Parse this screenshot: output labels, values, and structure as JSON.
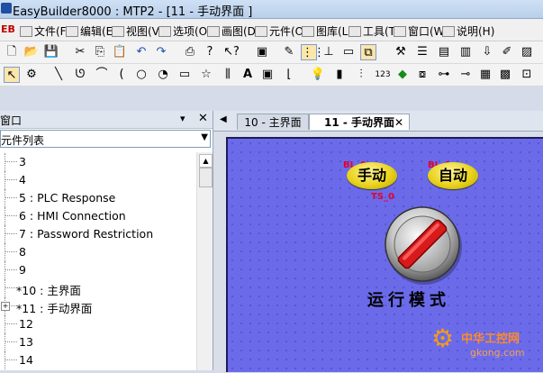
{
  "titlebar": {
    "title": "EasyBuilder8000 : MTP2 - [11 - 手动界面 ]"
  },
  "menubar": {
    "logo": "EB",
    "items": [
      {
        "label": "文件(F)"
      },
      {
        "label": "编辑(E)"
      },
      {
        "label": "视图(V)"
      },
      {
        "label": "选项(O)"
      },
      {
        "label": "画图(D)"
      },
      {
        "label": "元件(O)"
      },
      {
        "label": "图库(L)"
      },
      {
        "label": "工具(T)"
      },
      {
        "label": "窗口(W)"
      },
      {
        "label": "说明(H)"
      }
    ]
  },
  "toolbar1": {
    "icons": [
      "new-file-icon",
      "open-folder-icon",
      "save-icon",
      "cut-icon",
      "copy-icon",
      "paste-icon",
      "undo-icon",
      "redo-icon",
      "print-icon",
      "help-icon",
      "context-help-icon",
      "component-icon",
      "pen-icon",
      "grid-icon",
      "align-icon",
      "frame-icon",
      "overlap-icon",
      "tools-icon",
      "compile-icon",
      "offline-sim-icon",
      "online-sim-icon",
      "download-icon",
      "edit-icon",
      "picture-icon",
      "settings-icon"
    ]
  },
  "toolbar2": {
    "icons": [
      "pointer-icon",
      "property-icon",
      "line-icon",
      "polyline-icon",
      "arc-icon",
      "curve-icon",
      "circle-icon",
      "pie-icon",
      "rectangle-icon",
      "star-icon",
      "scale-icon",
      "text-icon",
      "picture-shape-icon",
      "bracket-icon",
      "bulb-icon",
      "traffic-light-icon",
      "slider-icon",
      "numeric-icon",
      "diamond-icon",
      "window-icon",
      "switch-icon",
      "io-icon",
      "meter-icon",
      "ascii-icon",
      "trend-icon"
    ]
  },
  "leftpanel": {
    "title": "窗口",
    "pin_glyph": "▾",
    "close_glyph": "✕",
    "combo_value": "元件列表",
    "rows": [
      {
        "label": "3"
      },
      {
        "label": "4"
      },
      {
        "label": "5 : PLC Response"
      },
      {
        "label": "6 : HMI Connection"
      },
      {
        "label": "7 : Password Restriction"
      },
      {
        "label": "8"
      },
      {
        "label": "9"
      },
      {
        "label": "*10 : 主界面"
      },
      {
        "label": "*11 : 手动界面",
        "expandable": true
      },
      {
        "label": "12"
      },
      {
        "label": "13"
      },
      {
        "label": "14"
      }
    ]
  },
  "tabs": {
    "nav_left": "◀",
    "items": [
      {
        "label": "10 - 主界面",
        "active": false
      },
      {
        "label": "11 - 手动界面",
        "active": true
      }
    ],
    "close_glyph": "✕"
  },
  "screen": {
    "bg_color": "#6b6bea",
    "manual_button": {
      "address": "BL_0",
      "label": "手动"
    },
    "auto_button": {
      "address": "BL_1",
      "label": "自动"
    },
    "selector_switch": {
      "address": "TS_0"
    },
    "mode_label": "运行模式",
    "watermark": {
      "cn": "中华工控网",
      "en": "gkong.com"
    }
  }
}
